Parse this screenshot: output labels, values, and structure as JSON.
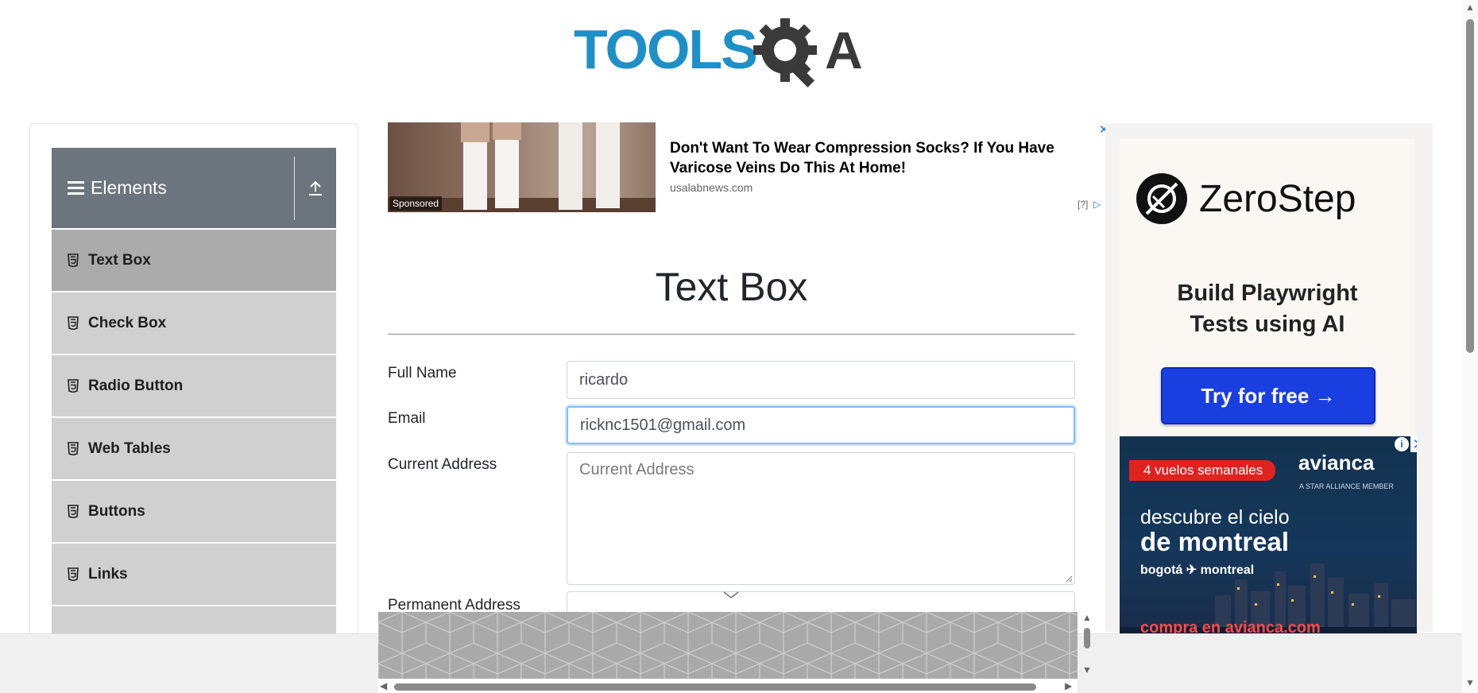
{
  "header": {
    "logo_text": "TOOLSQA"
  },
  "sidebar": {
    "group_title": "Elements",
    "items": [
      {
        "label": "Text Box"
      },
      {
        "label": "Check Box"
      },
      {
        "label": "Radio Button"
      },
      {
        "label": "Web Tables"
      },
      {
        "label": "Buttons"
      },
      {
        "label": "Links"
      },
      {
        "label": ""
      }
    ],
    "active_index": 0
  },
  "top_ad": {
    "sponsored": "Sponsored",
    "headline": "Don't Want To Wear Compression Socks? If You Have Varicose Veins Do This At Home!",
    "domain": "usalabnews.com",
    "help": "[?]"
  },
  "main": {
    "title": "Text Box",
    "full_name_label": "Full Name",
    "full_name_value": "ricardo",
    "email_label": "Email",
    "email_value": "ricknc1501@gmail.com",
    "current_address_label": "Current Address",
    "current_address_placeholder": "Current Address",
    "permanent_address_label": "Permanent Address"
  },
  "right_ad": {
    "brand": "ZeroStep",
    "tagline_line1": "Build Playwright",
    "tagline_line2": "Tests using AI",
    "cta": "Try for free →"
  },
  "avianca_ad": {
    "badge": "4 vuelos semanales",
    "brand": "avianca",
    "sub": "A STAR ALLIANCE MEMBER",
    "line1": "descubre el cielo",
    "line2": "de montreal",
    "route": "bogotá ✈ montreal",
    "cta": "compra en avianca.com"
  },
  "colors": {
    "header_gray": "#6c757d",
    "menu_gray": "#d0d0d0",
    "active_gray": "#ababab",
    "logo_blue": "#1e90c8",
    "zerostep_blue": "#1a3fe0",
    "avianca_red": "#e1231f"
  }
}
